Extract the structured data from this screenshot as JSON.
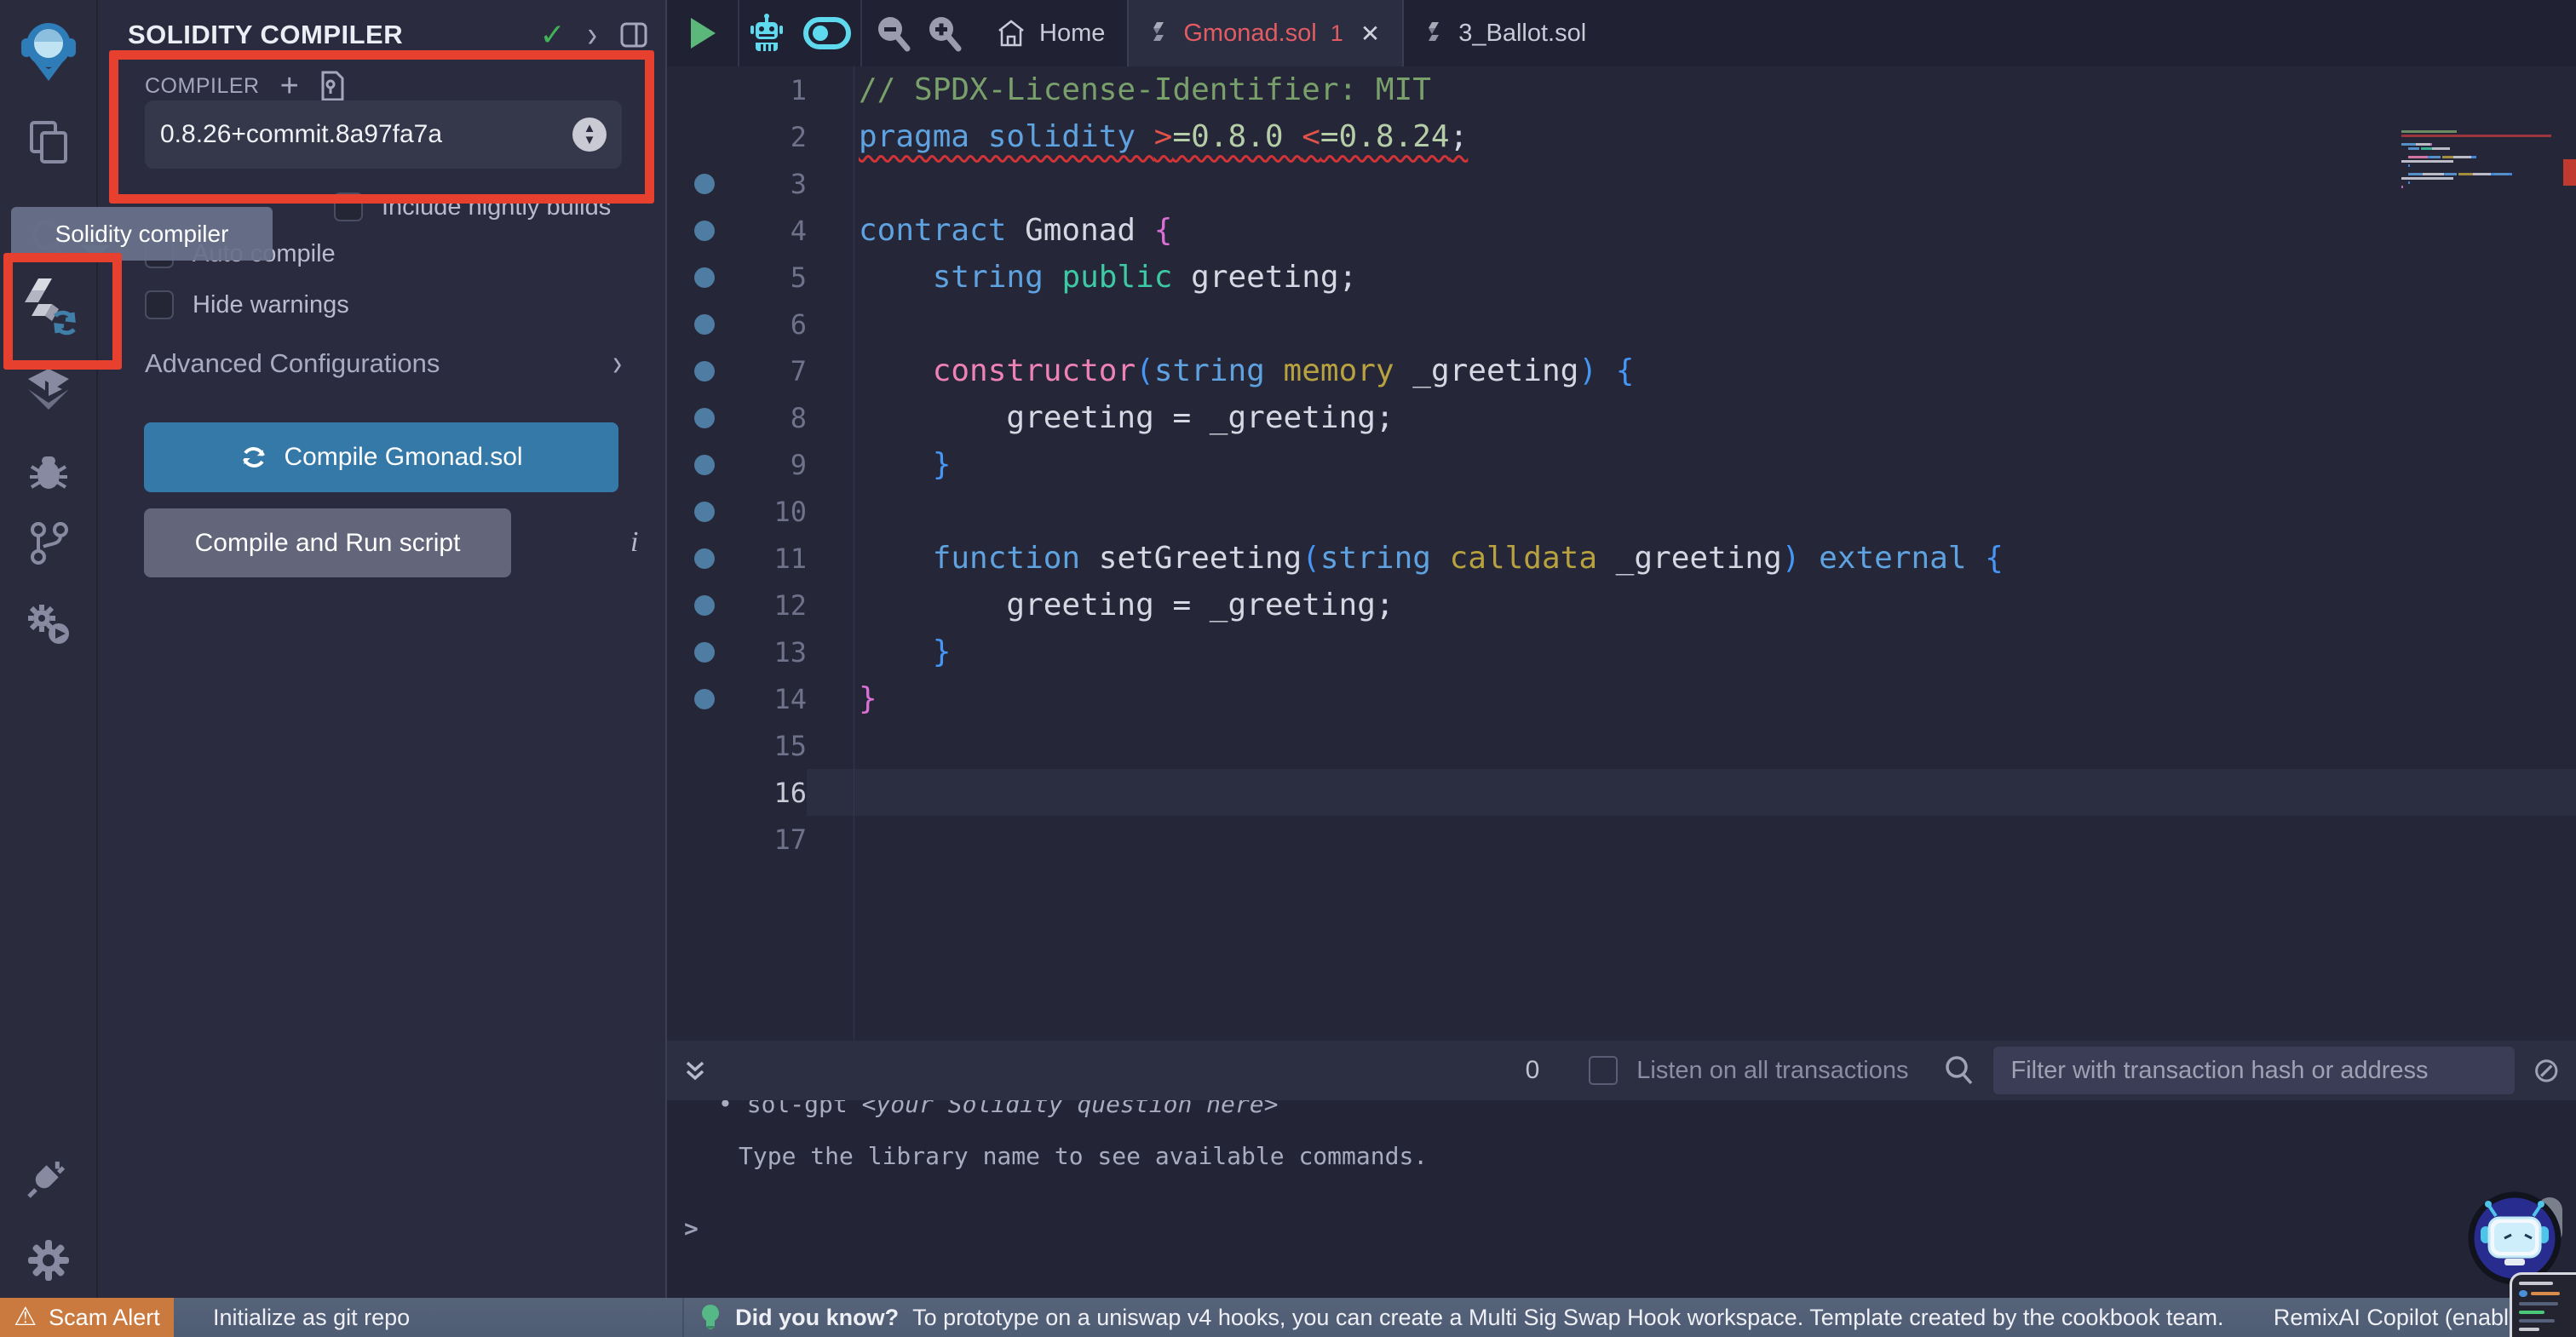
{
  "colors": {
    "comment": "#79a06b",
    "kw": "#5ea2e0",
    "bblue": "#4596f5",
    "op": "#e1534a",
    "num": "#b5cea8",
    "magenta": "#da70d6",
    "pink": "#ee82b4",
    "gold": "#b8a13f",
    "teal": "#3dc9a4",
    "plain": "#d6d7e2",
    "annotation_red": "#e8402e",
    "compile_button_blue": "#3579a8",
    "error_text": "#e25d63",
    "minimap_error_bar": "#b5383d",
    "gutter_dot": "#4e7ca2"
  },
  "activity_bar": {
    "icons": [
      "remix-logo",
      "file-explorer",
      "search",
      "solidity-compiler",
      "deploy-and-run",
      "debugger",
      "git",
      "plugin-runner",
      "plugin-manager",
      "settings"
    ]
  },
  "side_panel": {
    "title": "SOLIDITY COMPILER",
    "section_label": "COMPILER",
    "compiler_version": "0.8.26+commit.8a97fa7a",
    "checkbox_nightly": "Include nightly builds",
    "checkbox_autocompile": "Auto compile",
    "checkbox_hide_warnings": "Hide warnings",
    "advanced_label": "Advanced Configurations",
    "compile_button": "Compile Gmonad.sol",
    "compile_run_button": "Compile and Run script"
  },
  "tooltip": {
    "text": "Solidity compiler"
  },
  "editor": {
    "tabs": [
      {
        "label": "Home"
      },
      {
        "label": "Gmonad.sol",
        "badge": "1",
        "active": true
      },
      {
        "label": "3_Ballot.sol"
      }
    ],
    "code": {
      "current_line": 16,
      "dot_lines": [
        3,
        4,
        5,
        6,
        7,
        8,
        9,
        10,
        11,
        12,
        13,
        14
      ],
      "lines": [
        {
          "n": 1,
          "tokens": [
            {
              "t": "// SPDX-License-Identifier: MIT",
              "c": "comment"
            }
          ]
        },
        {
          "n": 2,
          "error": true,
          "tokens": [
            {
              "t": "pragma solidity ",
              "c": "kw"
            },
            {
              "t": ">",
              "c": "op"
            },
            {
              "t": "=0.8.0 ",
              "c": "num"
            },
            {
              "t": "<",
              "c": "op"
            },
            {
              "t": "=0.8.24",
              "c": "num"
            },
            {
              "t": ";",
              "c": "plain"
            }
          ]
        },
        {
          "n": 3,
          "tokens": []
        },
        {
          "n": 4,
          "tokens": [
            {
              "t": "contract",
              "c": "kw"
            },
            {
              "t": " Gmonad ",
              "c": "plain"
            },
            {
              "t": "{",
              "c": "magenta"
            }
          ]
        },
        {
          "n": 5,
          "tokens": [
            {
              "t": "    ",
              "c": "plain"
            },
            {
              "t": "string",
              "c": "kw"
            },
            {
              "t": " ",
              "c": "plain"
            },
            {
              "t": "public",
              "c": "teal"
            },
            {
              "t": " greeting;",
              "c": "plain"
            }
          ]
        },
        {
          "n": 6,
          "tokens": []
        },
        {
          "n": 7,
          "tokens": [
            {
              "t": "    ",
              "c": "plain"
            },
            {
              "t": "constructor",
              "c": "pink"
            },
            {
              "t": "(",
              "c": "bblue"
            },
            {
              "t": "string",
              "c": "kw"
            },
            {
              "t": " ",
              "c": "plain"
            },
            {
              "t": "memory",
              "c": "gold"
            },
            {
              "t": " _greeting",
              "c": "plain"
            },
            {
              "t": ") {",
              "c": "bblue"
            }
          ]
        },
        {
          "n": 8,
          "tokens": [
            {
              "t": "        greeting = _greeting;",
              "c": "plain"
            }
          ]
        },
        {
          "n": 9,
          "tokens": [
            {
              "t": "    ",
              "c": "plain"
            },
            {
              "t": "}",
              "c": "bblue"
            }
          ]
        },
        {
          "n": 10,
          "tokens": []
        },
        {
          "n": 11,
          "tokens": [
            {
              "t": "    ",
              "c": "plain"
            },
            {
              "t": "function",
              "c": "kw"
            },
            {
              "t": " setGreeting",
              "c": "plain"
            },
            {
              "t": "(",
              "c": "bblue"
            },
            {
              "t": "string",
              "c": "kw"
            },
            {
              "t": " ",
              "c": "plain"
            },
            {
              "t": "calldata",
              "c": "gold"
            },
            {
              "t": " _greeting",
              "c": "plain"
            },
            {
              "t": ") ",
              "c": "bblue"
            },
            {
              "t": "external",
              "c": "kw"
            },
            {
              "t": " {",
              "c": "bblue"
            }
          ]
        },
        {
          "n": 12,
          "tokens": [
            {
              "t": "        greeting = _greeting;",
              "c": "plain"
            }
          ]
        },
        {
          "n": 13,
          "tokens": [
            {
              "t": "    ",
              "c": "plain"
            },
            {
              "t": "}",
              "c": "bblue"
            }
          ]
        },
        {
          "n": 14,
          "tokens": [
            {
              "t": "}",
              "c": "magenta"
            }
          ]
        },
        {
          "n": 15,
          "tokens": []
        },
        {
          "n": 16,
          "tokens": []
        },
        {
          "n": 17,
          "tokens": []
        }
      ]
    }
  },
  "terminal": {
    "bar": {
      "count": "0",
      "listen_label": "Listen on all transactions",
      "filter_placeholder": "Filter with transaction hash or address"
    },
    "content": {
      "bullet": "•",
      "gpt_cmd": "sol-gpt ",
      "gpt_arg": "<your Solidity question here>",
      "help_line": "Type the library name to see available commands.",
      "prompt": ">"
    }
  },
  "status_bar": {
    "scam_alert": "Scam Alert",
    "git_label": "Initialize as git repo",
    "tip_title": "Did you know?",
    "tip_text": "To prototype on a uniswap v4 hooks, you can create a Multi Sig Swap Hook workspace. Template created by the cookbook team.",
    "right_label": "RemixAI Copilot (enabled)"
  }
}
